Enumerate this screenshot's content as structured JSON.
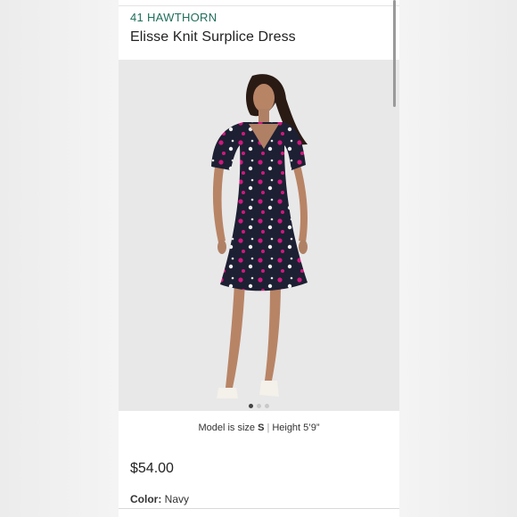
{
  "product": {
    "brand": "41 HAWTHORN",
    "title": "Elisse Knit Surplice Dress",
    "image_alt": "model-wearing-floral-dress",
    "carousel": {
      "count": 3,
      "active": 1
    },
    "model_size_prefix": "Model is size ",
    "model_size": "S",
    "separator": "|",
    "model_height_prefix": "Height ",
    "model_height": "5’9”",
    "price": "$54.00",
    "color_label": "Color:",
    "color_value": "Navy"
  },
  "colors": {
    "brand": "#1f6e5c",
    "dress": "#1d1f33",
    "print_pink": "#d0187e",
    "print_white": "#f2f2f2"
  }
}
